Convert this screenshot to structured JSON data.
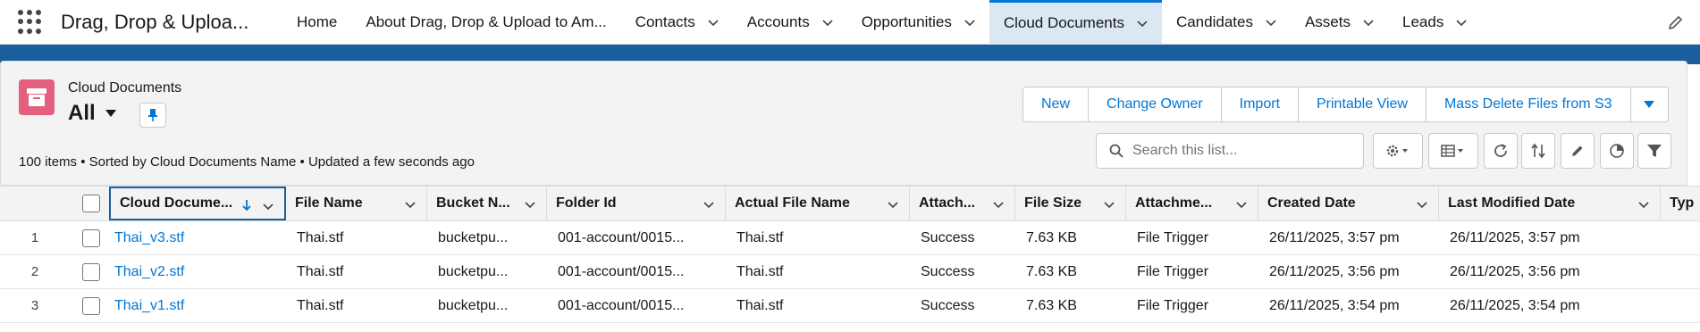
{
  "app": {
    "name": "Drag, Drop & Uploa..."
  },
  "nav": {
    "tabs": [
      {
        "label": "Home",
        "has_menu": false
      },
      {
        "label": "About Drag, Drop & Upload to Am...",
        "has_menu": false
      },
      {
        "label": "Contacts",
        "has_menu": true
      },
      {
        "label": "Accounts",
        "has_menu": true
      },
      {
        "label": "Opportunities",
        "has_menu": true
      },
      {
        "label": "Cloud Documents",
        "has_menu": true,
        "active": true
      },
      {
        "label": "Candidates",
        "has_menu": true
      },
      {
        "label": "Assets",
        "has_menu": true
      },
      {
        "label": "Leads",
        "has_menu": true
      }
    ]
  },
  "header": {
    "object_type": "Cloud Documents",
    "view_name": "All",
    "status": "100 items • Sorted by Cloud Documents Name • Updated a few seconds ago",
    "actions": [
      "New",
      "Change Owner",
      "Import",
      "Printable View",
      "Mass Delete Files from S3"
    ],
    "search_placeholder": "Search this list..."
  },
  "table": {
    "columns": [
      "Cloud Docume...",
      "File Name",
      "Bucket N...",
      "Folder Id",
      "Actual File Name",
      "Attach...",
      "File Size",
      "Attachme...",
      "Created Date",
      "Last Modified Date",
      "Typ"
    ],
    "rows": [
      {
        "num": "1",
        "cells": [
          "Thai_v3.stf",
          "Thai.stf",
          "bucketpu...",
          "001-account/0015...",
          "Thai.stf",
          "Success",
          "7.63 KB",
          "File Trigger",
          "26/11/2025, 3:57 pm",
          "26/11/2025, 3:57 pm"
        ]
      },
      {
        "num": "2",
        "cells": [
          "Thai_v2.stf",
          "Thai.stf",
          "bucketpu...",
          "001-account/0015...",
          "Thai.stf",
          "Success",
          "7.63 KB",
          "File Trigger",
          "26/11/2025, 3:56 pm",
          "26/11/2025, 3:56 pm"
        ]
      },
      {
        "num": "3",
        "cells": [
          "Thai_v1.stf",
          "Thai.stf",
          "bucketpu...",
          "001-account/0015...",
          "Thai.stf",
          "Success",
          "7.63 KB",
          "File Trigger",
          "26/11/2025, 3:54 pm",
          "26/11/2025, 3:54 pm"
        ]
      }
    ]
  },
  "colors": {
    "brand": "#0176d3",
    "object_icon": "#e3607f",
    "band": "#1b5e9e"
  }
}
